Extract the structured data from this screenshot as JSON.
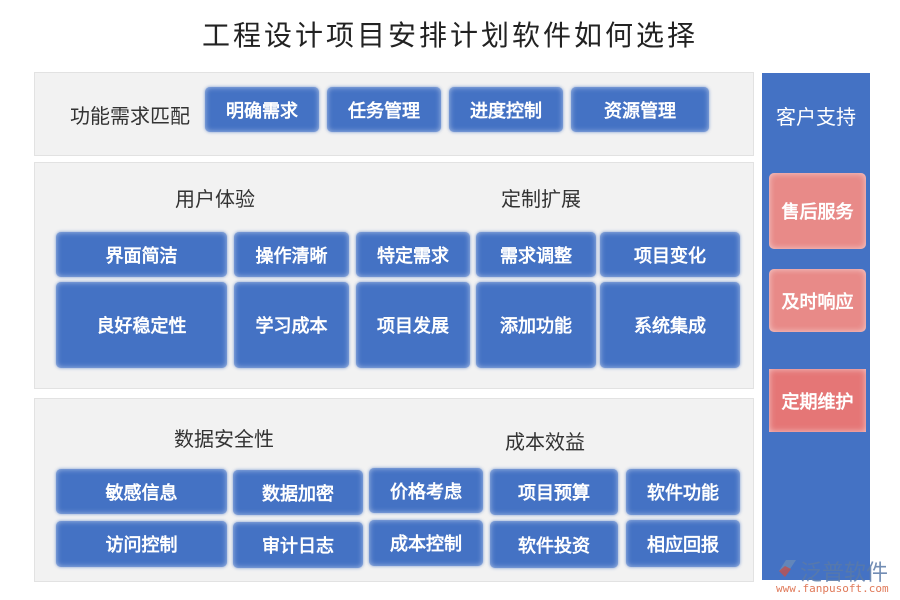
{
  "title": "工程设计项目安排计划软件如何选择",
  "functional": {
    "heading": "功能需求匹配",
    "items": [
      "明确需求",
      "任务管理",
      "进度控制",
      "资源管理"
    ]
  },
  "user_experience": {
    "heading": "用户体验",
    "row1": [
      "界面简洁",
      "操作清晰"
    ],
    "row2": [
      "良好稳定性",
      "学习成本"
    ]
  },
  "customization": {
    "heading": "定制扩展",
    "row1": [
      "特定需求",
      "需求调整",
      "项目变化"
    ],
    "row2": [
      "项目发展",
      "添加功能",
      "系统集成"
    ]
  },
  "data_security": {
    "heading": "数据安全性",
    "row1": [
      "敏感信息",
      "数据加密"
    ],
    "row2": [
      "访问控制",
      "审计日志"
    ]
  },
  "cost_benefit": {
    "heading": "成本效益",
    "row1": [
      "价格考虑",
      "项目预算",
      "软件功能"
    ],
    "row2": [
      "成本控制",
      "软件投资",
      "相应回报"
    ]
  },
  "customer_support": {
    "heading": "客户支持",
    "items": [
      "售后服务",
      "及时响应",
      "定期维护"
    ]
  },
  "watermark": {
    "brand": "泛普软件",
    "url": "www.fanpusoft.com"
  },
  "colors": {
    "box_blue": "#4472c4",
    "support_pink": "#e88a88",
    "panel_gray": "#f2f2f2"
  }
}
